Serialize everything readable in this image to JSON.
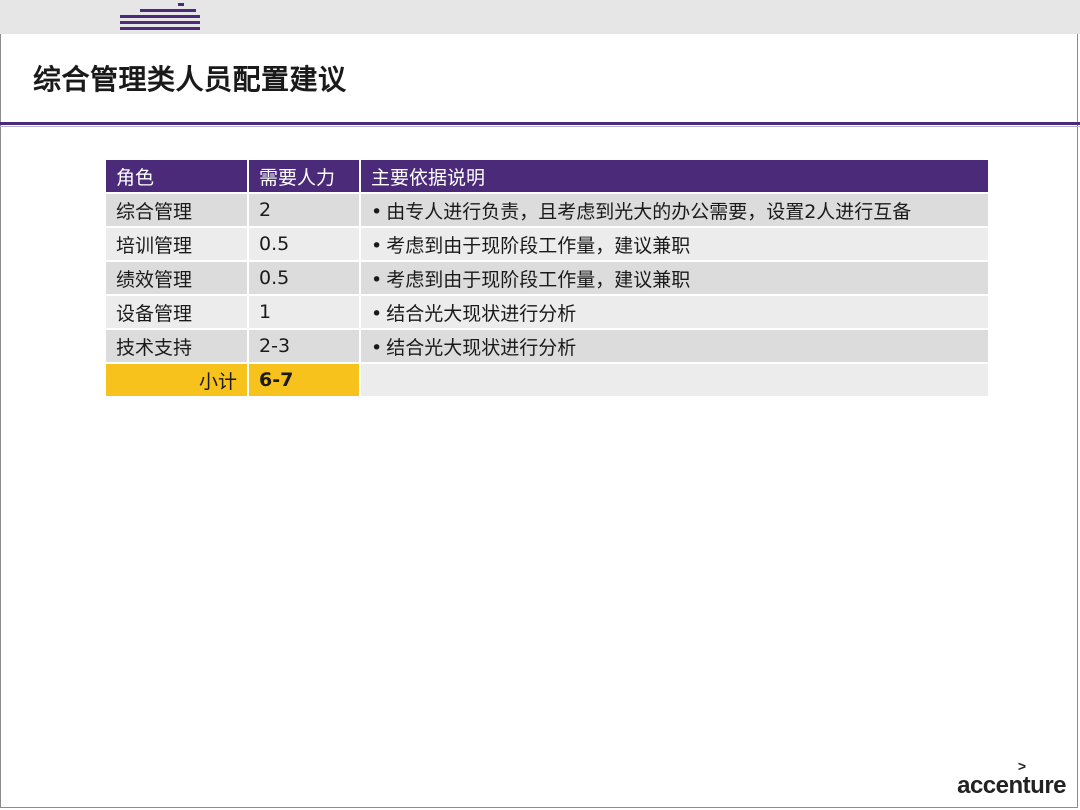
{
  "slide": {
    "title": "综合管理类人员配置建议"
  },
  "table": {
    "headers": [
      "角色",
      "需要人力",
      "主要依据说明"
    ],
    "rows": [
      {
        "role": "综合管理",
        "need": "2",
        "basis": "由专人进行负责，且考虑到光大的办公需要，设置2人进行互备"
      },
      {
        "role": "培训管理",
        "need": "0.5",
        "basis": "考虑到由于现阶段工作量，建议兼职"
      },
      {
        "role": "绩效管理",
        "need": "0.5",
        "basis": "考虑到由于现阶段工作量，建议兼职"
      },
      {
        "role": "设备管理",
        "need": "1",
        "basis": "结合光大现状进行分析"
      },
      {
        "role": "技术支持",
        "need": "2-3",
        "basis": "结合光大现状进行分析"
      }
    ],
    "total_label": "小计",
    "total_value": "6-7",
    "bullet": "•"
  },
  "brand": {
    "name": "accenture",
    "mark": ">"
  },
  "colors": {
    "header_bg": "#4b2a7a",
    "total_bg": "#f7c21b",
    "row_dark": "#dcdcdc",
    "row_light": "#ececec"
  }
}
